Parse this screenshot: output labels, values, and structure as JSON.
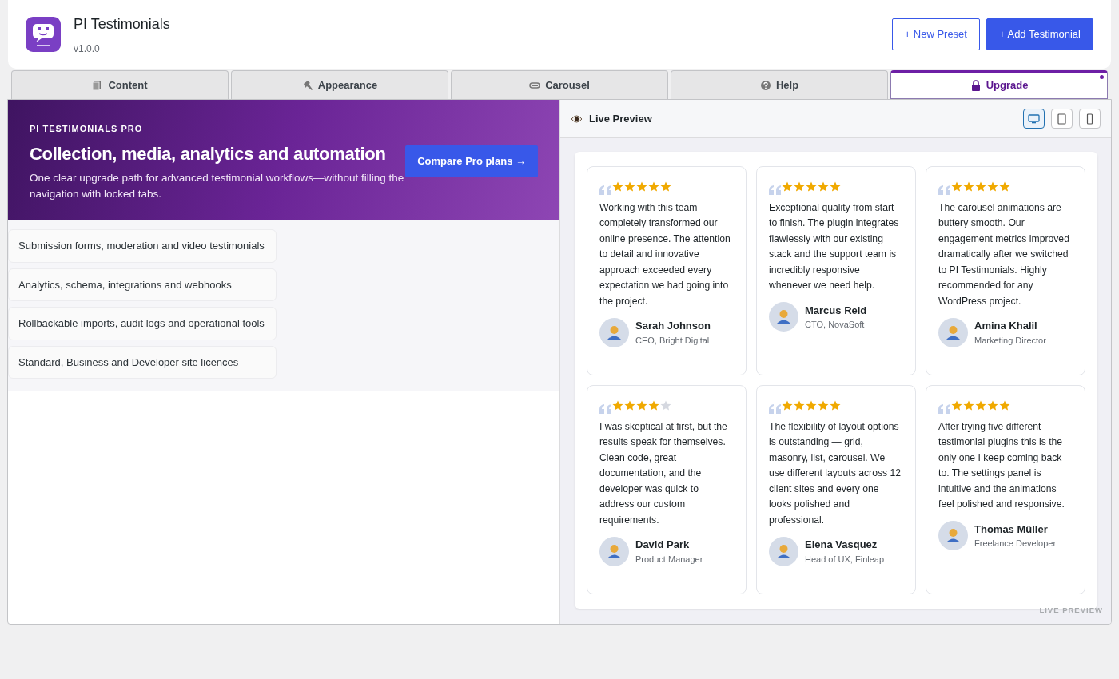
{
  "header": {
    "title": "PI Testimonials",
    "version": "v1.0.0",
    "buttons": [
      {
        "label": "+ New Preset",
        "kind": "outline"
      },
      {
        "label": "+ Add Testimonial",
        "kind": "primary"
      }
    ]
  },
  "tabs": [
    {
      "label": "Content",
      "kind": "content",
      "selected": false
    },
    {
      "label": "Appearance",
      "kind": "appearance",
      "selected": false
    },
    {
      "label": "Carousel",
      "kind": "carousel",
      "selected": false
    },
    {
      "label": "Help",
      "kind": "help",
      "selected": false
    },
    {
      "label": "Upgrade",
      "kind": "upgrade",
      "selected": true
    }
  ],
  "promo": {
    "eyebrow": "PI TESTIMONIALS PRO",
    "title": "Collection, media, analytics and automation",
    "text": "One clear upgrade path for advanced testimonial workflows—without filling the navigation with locked tabs.",
    "button": "Compare Pro plans →"
  },
  "features": [
    "Submission forms, moderation and video testimonials",
    "Analytics, schema, integrations and webhooks",
    "Rollbackable imports, audit logs and operational tools",
    "Standard, Business and Developer site licences"
  ],
  "preview": {
    "title": "Live Preview",
    "devices": [
      {
        "kind": "desktop",
        "selected": true
      },
      {
        "kind": "tablet",
        "selected": false
      },
      {
        "kind": "phone",
        "selected": false
      }
    ],
    "footer": "LIVE PREVIEW",
    "testimonials": [
      {
        "stars": 5,
        "text": "Working with this team completely transformed our online presence. The attention to detail and innovative approach exceeded every expectation we had going into the project.",
        "name": "Sarah Johnson",
        "role": "CEO, Bright Digital"
      },
      {
        "stars": 5,
        "text": "Exceptional quality from start to finish. The plugin integrates flawlessly with our existing stack and the support team is incredibly responsive whenever we need help.",
        "name": "Marcus Reid",
        "role": "CTO, NovaSoft"
      },
      {
        "stars": 5,
        "text": "The carousel animations are buttery smooth. Our engagement metrics improved dramatically after we switched to PI Testimonials. Highly recommended for any WordPress project.",
        "name": "Amina Khalil",
        "role": "Marketing Director"
      },
      {
        "stars": 4,
        "text": "I was skeptical at first, but the results speak for themselves. Clean code, great documentation, and the developer was quick to address our custom requirements.",
        "name": "David Park",
        "role": "Product Manager"
      },
      {
        "stars": 5,
        "text": "The flexibility of layout options is outstanding — grid, masonry, list, carousel. We use different layouts across 12 client sites and every one looks polished and professional.",
        "name": "Elena Vasquez",
        "role": "Head of UX, Finleap"
      },
      {
        "stars": 5,
        "text": "After trying five different testimonial plugins this is the only one I keep coming back to. The settings panel is intuitive and the animations feel polished and responsive.",
        "name": "Thomas Müller",
        "role": "Freelance Developer"
      }
    ]
  }
}
